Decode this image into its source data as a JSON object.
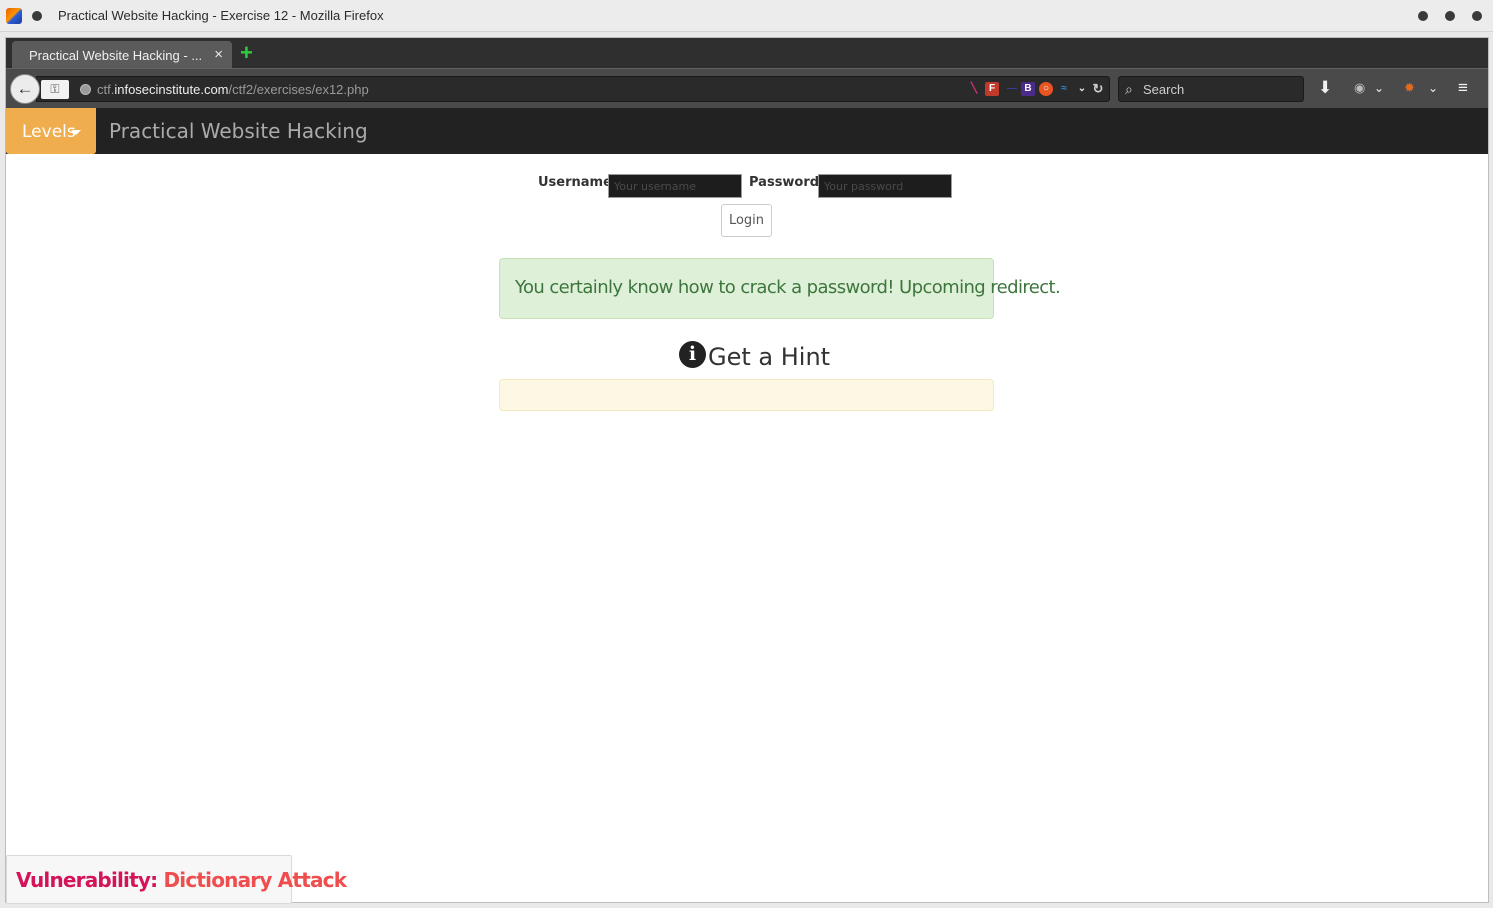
{
  "os": {
    "window_title": "Practical Website Hacking - Exercise 12 - Mozilla Firefox"
  },
  "browser": {
    "tab_title": "Practical Website Hacking - ...",
    "tab_close": "×",
    "new_tab": "+",
    "url_prefix": "ctf.",
    "url_host": "infosecinstitute.com",
    "url_path": "/ctf2/exercises/ex12.php",
    "search_placeholder": "Search",
    "extensions": [
      "feather-icon",
      "f-icon",
      "b-icon",
      "ubuntu-icon",
      "wave-icon"
    ]
  },
  "site": {
    "levels_label": "Levels",
    "brand": "Practical Website Hacking",
    "username_label": "Username:",
    "username_placeholder": "Your username",
    "password_label": "Password:",
    "password_placeholder": "Your password",
    "login_label": "Login",
    "success_message": "You certainly know how to crack a password! Upcoming redirect.",
    "hint_icon": "i",
    "hint_title": "Get a Hint",
    "vulnerability_label": "Vulnerability:",
    "vulnerability_value": "Dictionary Attack"
  },
  "colors": {
    "levels_button": "#f0ad4e",
    "success_bg": "#dff0d8",
    "success_text": "#3c763d",
    "hint_bg": "#fcf8e3",
    "vuln_label": "#d4145a"
  }
}
